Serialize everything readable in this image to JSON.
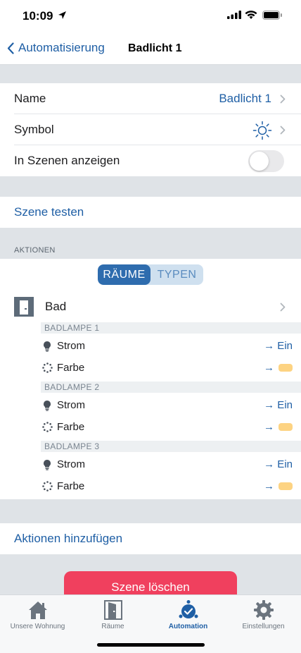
{
  "status": {
    "time": "10:09"
  },
  "nav": {
    "back_label": "Automatisierung",
    "title": "Badlicht 1"
  },
  "settings": {
    "name_label": "Name",
    "name_value": "Badlicht 1",
    "symbol_label": "Symbol",
    "symbol_icon": "sun-icon",
    "show_in_scenes_label": "In Szenen anzeigen",
    "show_in_scenes_on": false
  },
  "test_scene_label": "Szene testen",
  "actions": {
    "header": "AKTIONEN",
    "segments": [
      "RÄUME",
      "TYPEN"
    ],
    "selected_segment": "RÄUME",
    "room": {
      "name": "Bad",
      "devices": [
        {
          "name": "BADLAMPE 1",
          "actions": [
            {
              "label": "Strom",
              "value": "→ Ein"
            },
            {
              "label": "Farbe",
              "arrow": "→",
              "color": "#fdd382"
            }
          ]
        },
        {
          "name": "BADLAMPE 2",
          "actions": [
            {
              "label": "Strom",
              "value": "→ Ein"
            },
            {
              "label": "Farbe",
              "arrow": "→",
              "color": "#fdd382"
            }
          ]
        },
        {
          "name": "BADLAMPE 3",
          "actions": [
            {
              "label": "Strom",
              "value": "→ Ein"
            },
            {
              "label": "Farbe",
              "arrow": "→",
              "color": "#fdd382"
            }
          ]
        }
      ]
    }
  },
  "add_actions_label": "Aktionen hinzufügen",
  "delete_button_label": "Szene löschen",
  "tabs": [
    {
      "label": "Unsere Wohnung",
      "icon": "house-icon",
      "active": false
    },
    {
      "label": "Räume",
      "icon": "door-icon",
      "active": false
    },
    {
      "label": "Automation",
      "icon": "automation-check-icon",
      "active": true
    },
    {
      "label": "Einstellungen",
      "icon": "gear-icon",
      "active": false
    }
  ],
  "colors": {
    "accent": "#1f5fa5",
    "destructive": "#f0405e",
    "background": "#dfe3e7",
    "swatch": "#fdd382"
  }
}
